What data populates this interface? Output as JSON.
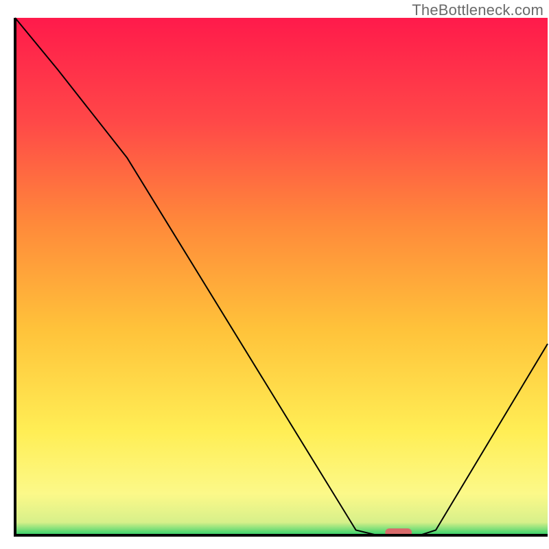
{
  "watermark": "TheBottleneck.com",
  "chart_data": {
    "type": "line",
    "title": "",
    "xlabel": "",
    "ylabel": "",
    "x": [
      0.0,
      0.08,
      0.21,
      0.64,
      0.68,
      0.76,
      0.79,
      1.0
    ],
    "values": [
      1.0,
      0.9,
      0.73,
      0.01,
      0.0,
      0.0,
      0.01,
      0.37
    ],
    "xlim": [
      0,
      1
    ],
    "ylim": [
      0,
      1
    ],
    "grid": false,
    "marker": {
      "x": 0.72,
      "width": 0.05,
      "y": 0.0,
      "color": "#d86b6b"
    },
    "background": {
      "type": "vertical-gradient",
      "stops": [
        {
          "pos": 0.0,
          "color": "#ff1a4b"
        },
        {
          "pos": 0.2,
          "color": "#ff4848"
        },
        {
          "pos": 0.4,
          "color": "#ff8a3a"
        },
        {
          "pos": 0.6,
          "color": "#ffc23a"
        },
        {
          "pos": 0.8,
          "color": "#ffee55"
        },
        {
          "pos": 0.92,
          "color": "#fcf989"
        },
        {
          "pos": 0.975,
          "color": "#d7f08a"
        },
        {
          "pos": 1.0,
          "color": "#2fd06a"
        }
      ]
    },
    "axis_color": "#000000",
    "line_color": "#000000",
    "line_width": 2
  }
}
